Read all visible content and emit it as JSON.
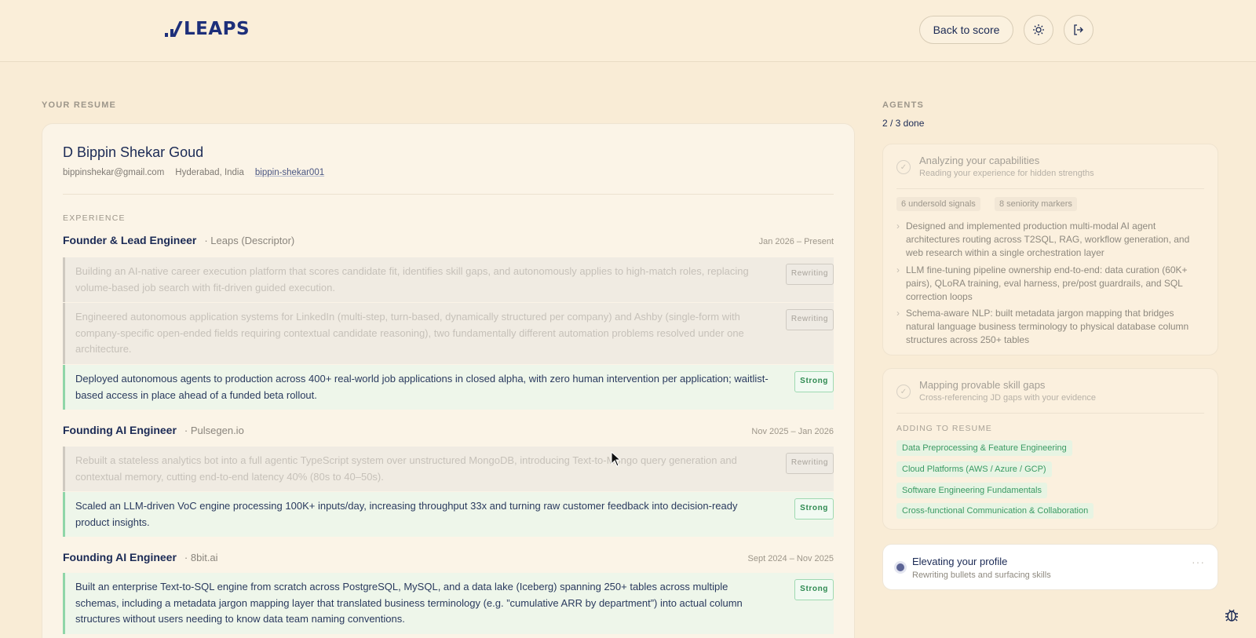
{
  "header": {
    "logo_text": "LEAPS",
    "back_label": "Back to score",
    "theme_icon": "sun-icon",
    "logout_icon": "logout-icon"
  },
  "resume": {
    "section_label": "YOUR RESUME",
    "name": "D Bippin Shekar Goud",
    "email": "bippinshekar@gmail.com",
    "location": "Hyderabad, India",
    "handle": "bippin-shekar001",
    "experience_label": "EXPERIENCE",
    "jobs": [
      {
        "title": "Founder & Lead Engineer",
        "company": "· Leaps (Descriptor)",
        "dates": "Jan 2026 – Present",
        "bullets": [
          {
            "text": "Building an AI-native career execution platform that scores candidate fit, identifies skill gaps, and autonomously applies to high-match roles, replacing volume-based job search with fit-driven guided execution.",
            "status": "Rewriting"
          },
          {
            "text": "Engineered autonomous application systems for LinkedIn (multi-step, turn-based, dynamically structured per company) and Ashby (single-form with company-specific open-ended fields requiring contextual candidate reasoning), two fundamentally different automation problems resolved under one architecture.",
            "status": "Rewriting"
          },
          {
            "text": "Deployed autonomous agents to production across 400+ real-world job applications in closed alpha, with zero human intervention per application; waitlist-based access in place ahead of a funded beta rollout.",
            "status": "Strong"
          }
        ]
      },
      {
        "title": "Founding AI Engineer",
        "company": "· Pulsegen.io",
        "dates": "Nov 2025 – Jan 2026",
        "bullets": [
          {
            "text": "Rebuilt a stateless analytics bot into a full agentic TypeScript system over unstructured MongoDB, introducing Text-to-Mongo query generation and contextual memory, cutting end-to-end latency 40% (80s to 40–50s).",
            "status": "Rewriting"
          },
          {
            "text": "Scaled an LLM-driven VoC engine processing 100K+ inputs/day, increasing throughput 33x and turning raw customer feedback into decision-ready product insights.",
            "status": "Strong"
          }
        ]
      },
      {
        "title": "Founding AI Engineer",
        "company": "· 8bit.ai",
        "dates": "Sept 2024 – Nov 2025",
        "bullets": [
          {
            "text": "Built an enterprise Text-to-SQL engine from scratch across PostgreSQL, MySQL, and a data lake (Iceberg) spanning 250+ tables across multiple schemas, including a metadata jargon mapping layer that translated business terminology (e.g. ”cumulative ARR by department”) into actual column structures without users needing to know data team naming conventions.",
            "status": "Strong"
          }
        ]
      }
    ]
  },
  "agents": {
    "section_label": "AGENTS",
    "status": "2 / 3 done",
    "capabilities": {
      "title": "Analyzing your capabilities",
      "subtitle": "Reading your experience for hidden strengths",
      "chips": [
        "6 undersold signals",
        "8 seniority markers"
      ],
      "bullets": [
        "Designed and implemented production multi-modal AI agent architectures routing across T2SQL, RAG, workflow generation, and web research within a single orchestration layer",
        "LLM fine-tuning pipeline ownership end-to-end: data curation (60K+ pairs), QLoRA training, eval harness, pre/post guardrails, and SQL correction loops",
        "Schema-aware NLP: built metadata jargon mapping that bridges natural language business terminology to physical database column structures across 250+ tables"
      ]
    },
    "gaps": {
      "title": "Mapping provable skill gaps",
      "subtitle": "Cross-referencing JD gaps with your evidence",
      "adding_label": "ADDING TO RESUME",
      "skills": [
        "Data Preprocessing & Feature Engineering",
        "Cloud Platforms (AWS / Azure / GCP)",
        "Software Engineering Fundamentals",
        "Cross-functional Communication & Collaboration"
      ]
    },
    "active": {
      "title": "Elevating your profile",
      "subtitle": "Rewriting bullets and surfacing skills"
    }
  }
}
